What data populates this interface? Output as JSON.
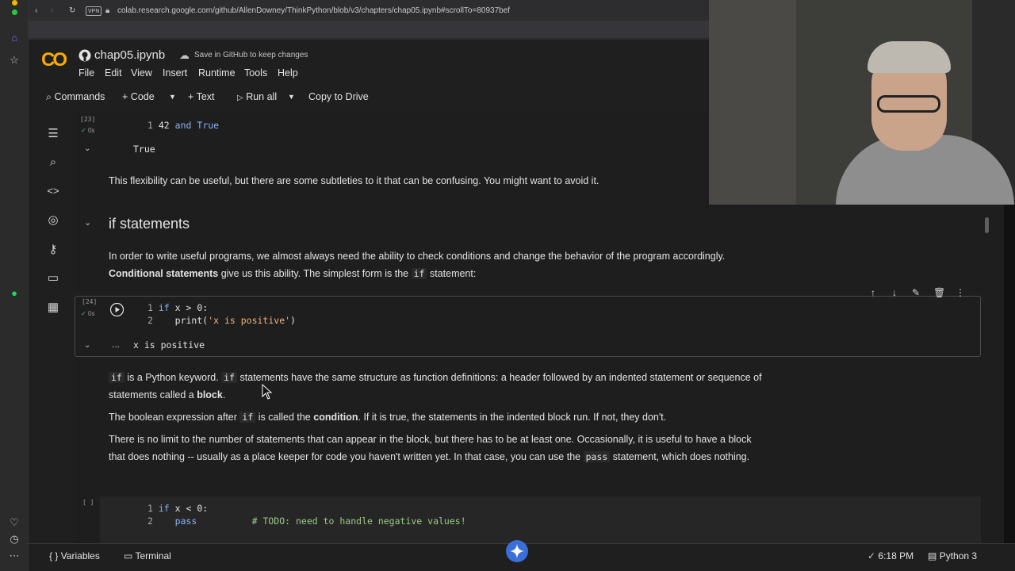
{
  "browser": {
    "url": "colab.research.google.com/github/AllenDowney/ThinkPython/blob/v3/chapters/chap05.ipynb#scrollTo=80937bef",
    "vpn_badge": "VPN"
  },
  "header": {
    "logo": "CO",
    "notebook_name": "chap05.ipynb",
    "save_notice": "Save in GitHub to keep changes"
  },
  "menu": [
    "File",
    "Edit",
    "View",
    "Insert",
    "Runtime",
    "Tools",
    "Help"
  ],
  "toolbar": {
    "commands": "Commands",
    "code": "Code",
    "text": "Text",
    "run_all": "Run all",
    "copy_to_drive": "Copy to Drive"
  },
  "cells": {
    "cell23": {
      "exec_count": "[23]",
      "time": "0s",
      "line_no": "1",
      "code_num": "42",
      "code_kw": "and",
      "code_val": "True",
      "output": "True"
    },
    "md1": "This flexibility can be useful, but there are some subtleties to it that can be confusing. You might want to avoid it.",
    "section_heading": "if statements",
    "md2": {
      "part1": "In order to write useful programs, we almost always need the ability to check conditions and change the behavior of the program accordingly.",
      "bold": "Conditional statements",
      "part2": "give us this ability. The simplest form is the",
      "code": "if",
      "part3": "statement:"
    },
    "cell24": {
      "exec_count": "[24]",
      "time": "0s",
      "line1_no": "1",
      "line1_kw": "if",
      "line1_rest": "x > 0:",
      "line2_no": "2",
      "line2_fn": "print(",
      "line2_str": "'x is positive'",
      "line2_end": ")",
      "output_ellipsis": "...",
      "output": "x is positive"
    },
    "md3": {
      "code1": "if",
      "part1": "is a Python keyword.",
      "code2": "if",
      "part2": "statements have the same structure as function definitions: a header followed by an indented statement or sequence of statements called a",
      "bold": "block",
      "end": "."
    },
    "md4": {
      "part1": "The boolean expression after",
      "code": "if",
      "part2": "is called the",
      "bold": "condition",
      "part3": ". If it is true, the statements in the indented block run. If not, they don't."
    },
    "md5": {
      "part1": "There is no limit to the number of statements that can appear in the block, but there has to be at least one. Occasionally, it is useful to have a block that does nothing -- usually as a place keeper for code you haven't written yet. In that case, you can use the",
      "code": "pass",
      "part2": "statement, which does nothing."
    },
    "cell25": {
      "exec_count": "[ ]",
      "line1_no": "1",
      "line1_kw": "if",
      "line1_rest": "x < 0:",
      "line2_no": "2",
      "line2_kw": "pass",
      "line2_comment": "# TODO: need to handle negative values!"
    }
  },
  "status": {
    "variables": "Variables",
    "terminal": "Terminal",
    "time": "6:18 PM",
    "runtime": "Python 3"
  }
}
